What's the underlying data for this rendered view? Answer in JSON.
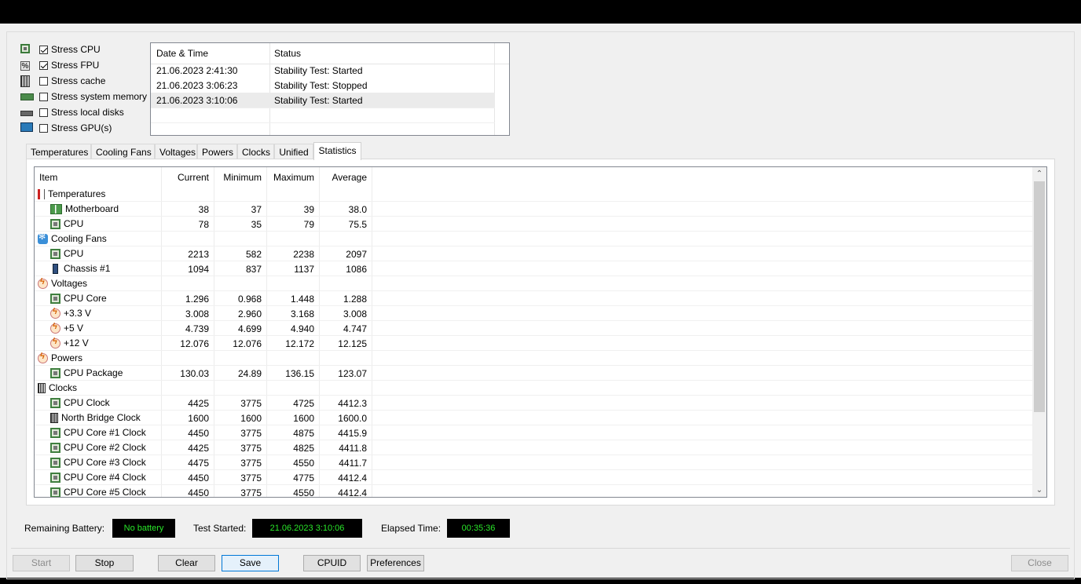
{
  "stress": [
    {
      "label": "Stress CPU",
      "checked": true,
      "icon": "cpu-chip-icon"
    },
    {
      "label": "Stress FPU",
      "checked": true,
      "icon": "fpu-icon"
    },
    {
      "label": "Stress cache",
      "checked": false,
      "icon": "cache-icon"
    },
    {
      "label": "Stress system memory",
      "checked": false,
      "icon": "memory-icon"
    },
    {
      "label": "Stress local disks",
      "checked": false,
      "icon": "disk-icon"
    },
    {
      "label": "Stress GPU(s)",
      "checked": false,
      "icon": "gpu-icon"
    }
  ],
  "fpu_icon_text": "%",
  "log": {
    "headers": [
      "Date & Time",
      "Status"
    ],
    "rows": [
      {
        "datetime": "21.06.2023 2:41:30",
        "status": "Stability Test: Started"
      },
      {
        "datetime": "21.06.2023 3:06:23",
        "status": "Stability Test: Stopped"
      },
      {
        "datetime": "21.06.2023 3:10:06",
        "status": "Stability Test: Started"
      }
    ]
  },
  "tabs": [
    "Temperatures",
    "Cooling Fans",
    "Voltages",
    "Powers",
    "Clocks",
    "Unified",
    "Statistics"
  ],
  "active_tab": "Statistics",
  "stats": {
    "headers": [
      "Item",
      "Current",
      "Minimum",
      "Maximum",
      "Average"
    ],
    "rows": [
      {
        "level": 0,
        "icon": "thermometer-icon",
        "name": "Temperatures"
      },
      {
        "level": 1,
        "icon": "motherboard-icon",
        "name": "Motherboard",
        "current": "38",
        "min": "37",
        "max": "39",
        "avg": "38.0"
      },
      {
        "level": 1,
        "icon": "cpu-chip-icon",
        "name": "CPU",
        "current": "78",
        "min": "35",
        "max": "79",
        "avg": "75.5"
      },
      {
        "level": 0,
        "icon": "fan-icon",
        "name": "Cooling Fans"
      },
      {
        "level": 1,
        "icon": "cpu-chip-icon",
        "name": "CPU",
        "current": "2213",
        "min": "582",
        "max": "2238",
        "avg": "2097"
      },
      {
        "level": 1,
        "icon": "chassis-icon",
        "name": "Chassis #1",
        "current": "1094",
        "min": "837",
        "max": "1137",
        "avg": "1086"
      },
      {
        "level": 0,
        "icon": "voltage-icon",
        "name": "Voltages"
      },
      {
        "level": 1,
        "icon": "cpu-chip-icon",
        "name": "CPU Core",
        "current": "1.296",
        "min": "0.968",
        "max": "1.448",
        "avg": "1.288"
      },
      {
        "level": 1,
        "icon": "voltage-icon",
        "name": "+3.3 V",
        "current": "3.008",
        "min": "2.960",
        "max": "3.168",
        "avg": "3.008"
      },
      {
        "level": 1,
        "icon": "voltage-icon",
        "name": "+5 V",
        "current": "4.739",
        "min": "4.699",
        "max": "4.940",
        "avg": "4.747"
      },
      {
        "level": 1,
        "icon": "voltage-icon",
        "name": "+12 V",
        "current": "12.076",
        "min": "12.076",
        "max": "12.172",
        "avg": "12.125"
      },
      {
        "level": 0,
        "icon": "voltage-icon",
        "name": "Powers"
      },
      {
        "level": 1,
        "icon": "cpu-chip-icon",
        "name": "CPU Package",
        "current": "130.03",
        "min": "24.89",
        "max": "136.15",
        "avg": "123.07"
      },
      {
        "level": 0,
        "icon": "clock-icon",
        "name": "Clocks"
      },
      {
        "level": 1,
        "icon": "cpu-chip-icon",
        "name": "CPU Clock",
        "current": "4425",
        "min": "3775",
        "max": "4725",
        "avg": "4412.3"
      },
      {
        "level": 1,
        "icon": "northbridge-icon",
        "name": "North Bridge Clock",
        "current": "1600",
        "min": "1600",
        "max": "1600",
        "avg": "1600.0"
      },
      {
        "level": 1,
        "icon": "cpu-chip-icon",
        "name": "CPU Core #1 Clock",
        "current": "4450",
        "min": "3775",
        "max": "4875",
        "avg": "4415.9"
      },
      {
        "level": 1,
        "icon": "cpu-chip-icon",
        "name": "CPU Core #2 Clock",
        "current": "4425",
        "min": "3775",
        "max": "4825",
        "avg": "4411.8"
      },
      {
        "level": 1,
        "icon": "cpu-chip-icon",
        "name": "CPU Core #3 Clock",
        "current": "4475",
        "min": "3775",
        "max": "4550",
        "avg": "4411.7"
      },
      {
        "level": 1,
        "icon": "cpu-chip-icon",
        "name": "CPU Core #4 Clock",
        "current": "4450",
        "min": "3775",
        "max": "4775",
        "avg": "4412.4"
      },
      {
        "level": 1,
        "icon": "cpu-chip-icon",
        "name": "CPU Core #5 Clock",
        "current": "4450",
        "min": "3775",
        "max": "4550",
        "avg": "4412.4"
      }
    ]
  },
  "status": {
    "battery_label": "Remaining Battery:",
    "battery_value": "No battery",
    "started_label": "Test Started:",
    "started_value": "21.06.2023 3:10:06",
    "elapsed_label": "Elapsed Time:",
    "elapsed_value": "00:35:36",
    "value_color": "#29e629"
  },
  "buttons": {
    "start": "Start",
    "stop": "Stop",
    "clear": "Clear",
    "save": "Save",
    "cpuid": "CPUID",
    "preferences": "Preferences",
    "close": "Close"
  }
}
